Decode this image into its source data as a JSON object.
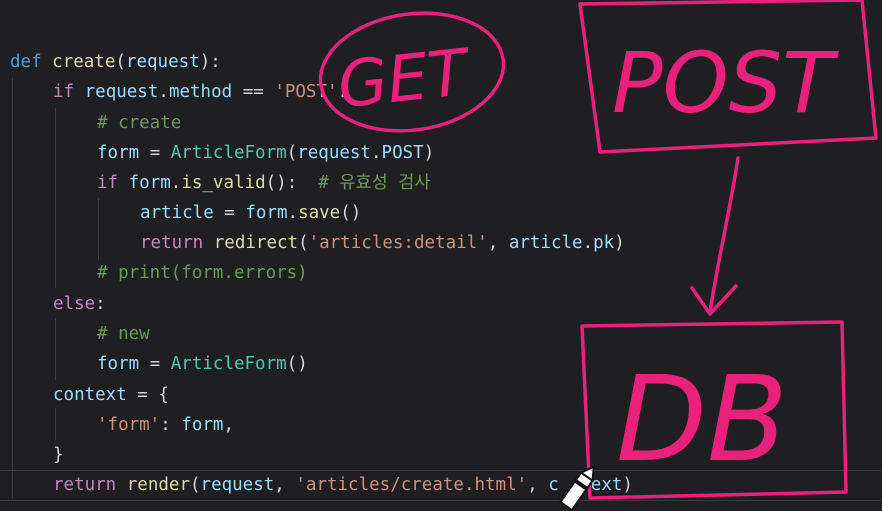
{
  "code": {
    "l1": {
      "def": "def",
      "name": "create",
      "open": "(",
      "param": "request",
      "close": "):"
    },
    "l2": {
      "if": "if",
      "obj": "request",
      "dot": ".",
      "attr": "method",
      "op": " == ",
      "str": "'POST'",
      "colon": ":"
    },
    "l3": {
      "comment": "# create"
    },
    "l4": {
      "var": "form",
      "eq": " = ",
      "cls": "ArticleForm",
      "open": "(",
      "obj": "request",
      "dot": ".",
      "attr": "POST",
      "close": ")"
    },
    "l5": {
      "if": "if",
      "obj": "form",
      "dot": ".",
      "fn": "is_valid",
      "call": "():",
      "comment": "  # 유효성 검사"
    },
    "l6": {
      "var": "article",
      "eq": " = ",
      "obj": "form",
      "dot": ".",
      "fn": "save",
      "call": "()"
    },
    "l7": {
      "ret": "return",
      "fn": "redirect",
      "open": "(",
      "str": "'articles:detail'",
      "comma": ", ",
      "obj": "article",
      "dot": ".",
      "attr": "pk",
      "close": ")"
    },
    "l8": {
      "comment": "# print(form.errors)"
    },
    "l9": {
      "else": "else",
      "colon": ":"
    },
    "l10": {
      "comment": "# new"
    },
    "l11": {
      "var": "form",
      "eq": " = ",
      "cls": "ArticleForm",
      "call": "()"
    },
    "l12": {
      "var": "context",
      "eq": " = ",
      "brace": "{"
    },
    "l13": {
      "str": "'form'",
      "colon": ": ",
      "var": "form",
      "comma": ","
    },
    "l14": {
      "brace": "}"
    },
    "l15": {
      "ret": "return",
      "fn": "render",
      "open": "(",
      "obj": "request",
      "comma": ", ",
      "str": "'articles/create.html'",
      "comma2": ", ",
      "rest1": "c",
      "rest2": "ext",
      "close": ")"
    }
  },
  "annotations": {
    "get": "GET",
    "post": "POST",
    "db": "DB",
    "ink_color": "#e8217a"
  }
}
